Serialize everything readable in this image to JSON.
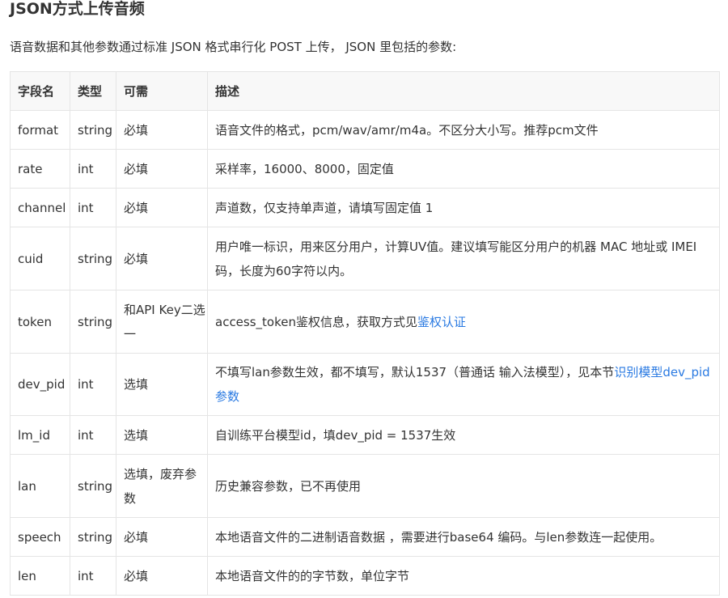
{
  "title": "JSON方式上传音频",
  "intro": "语音数据和其他参数通过标准 JSON 格式串行化 POST 上传， JSON 里包括的参数:",
  "table": {
    "headers": [
      "字段名",
      "类型",
      "可需",
      "描述"
    ],
    "rows": [
      {
        "name": "format",
        "type": "string",
        "req": "必填",
        "desc": "语音文件的格式，pcm/wav/amr/m4a。不区分大小写。推荐pcm文件"
      },
      {
        "name": "rate",
        "type": "int",
        "req": "必填",
        "desc": "采样率，16000、8000，固定值"
      },
      {
        "name": "channel",
        "type": "int",
        "req": "必填",
        "desc": "声道数，仅支持单声道，请填写固定值 1"
      },
      {
        "name": "cuid",
        "type": "string",
        "req": "必填",
        "desc": "用户唯一标识，用来区分用户，计算UV值。建议填写能区分用户的机器 MAC 地址或 IMEI 码，长度为60字符以内。"
      },
      {
        "name": "token",
        "type": "string",
        "req": "和API Key二选一",
        "desc": "access_token鉴权信息，获取方式见",
        "desc_link": "鉴权认证"
      },
      {
        "name": "dev_pid",
        "type": "int",
        "req": "选填",
        "desc": "不填写lan参数生效，都不填写，默认1537（普通话 输入法模型），见本节",
        "desc_link": "识别模型dev_pid参数"
      },
      {
        "name": "lm_id",
        "type": "int",
        "req": "选填",
        "desc": "自训练平台模型id，填dev_pid = 1537生效"
      },
      {
        "name": "lan",
        "type": "string",
        "req": "选填，废弃参数",
        "desc": "历史兼容参数，已不再使用"
      },
      {
        "name": "speech",
        "type": "string",
        "req": "必填",
        "desc": "本地语音文件的二进制语音数据 ，需要进行base64 编码。与len参数连一起使用。"
      },
      {
        "name": "len",
        "type": "int",
        "req": "必填",
        "desc": "本地语音文件的的字节数，单位字节"
      }
    ]
  },
  "colors": {
    "text": "#333333",
    "link": "#2a7ae2",
    "border": "#e5e5e5",
    "header_bg": "#f8f8f8"
  }
}
